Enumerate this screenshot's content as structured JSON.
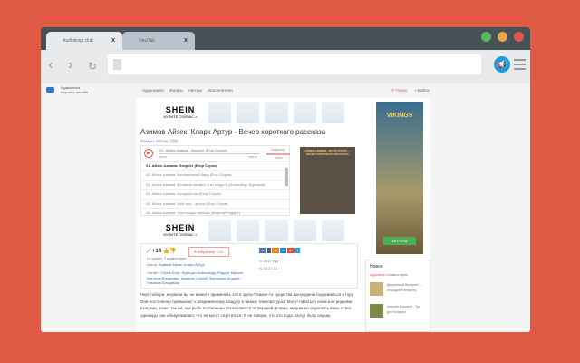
{
  "tabs": [
    {
      "label": "Audioknigi.club",
      "close": "x"
    },
    {
      "label": "NewTab",
      "close": "x"
    }
  ],
  "window_controls": {
    "colors": [
      "#5cb85c",
      "#e8a94b",
      "#e0544a"
    ]
  },
  "extension": {
    "icon": "megaphone-icon"
  },
  "site": {
    "logo_line1": "Аудиокниги",
    "logo_line2": "слушать онлайн",
    "nav": [
      "Аудиокниги",
      "Жанры",
      "Авторы",
      "Исполнители"
    ],
    "search": "Поиск",
    "login": "Войти",
    "ad_brand": "SHEIN",
    "ad_cta": "КУПИТЕ СЕЙЧАС >",
    "title": "Азимов Айзек, Кларк Артур - Вечер короткого рассказа",
    "genre": "РОМАН, ПРОЗА",
    "views": "776",
    "player": {
      "now": "01. Айзек Азимов. Эзорект (Егор Серов)",
      "time_start": "00:00",
      "time_end": "0:49:11",
      "speed_label": "Скорость",
      "speed": "1.0x",
      "volume": "100%"
    },
    "tracks": [
      "01. Айзек Азимов. Эзорект (Егор Серов)",
      "02. Айзек Азимов. Бессмертный бард (Егор Серов)",
      "03. Айзек Азимов. Вставьте шплинт А в гнездо Б (Александр Курицын)",
      "04. Айзек Азимов. Который час (Егор Серов)",
      "05. Айзек Азимов. Мой сын - физик (Егор Серов)",
      "06. Айзек Азимов. Настоящая любовь (Жирний Радцит)"
    ],
    "cover": "АЙЗЕК АЗИМОВ, АРТУР КЛАРК — ВЕЧЕР КОРОТКОГО РАССКАЗА",
    "rating": "+14",
    "favorite": "В избранное",
    "fav_count": "41",
    "comments": "14 лучших, 3 комментария",
    "author_label": "Автор:",
    "authors": "Азимов Айзек, Кларк Артур",
    "reader_label": "Читает:",
    "readers": "Серов Егор, Курицын Александр, Радцит Кирилл, Антонов Владимир, Казаков Сергей, Филиппов Андрей, Ломакин Владимир",
    "year": "2017 год",
    "duration": "02:17:21",
    "share": [
      "vk",
      "f",
      "ok",
      "m",
      "g+",
      "t"
    ],
    "description": "Черт побери, неужели вы не можете применить это в здесь? Какие-то существа вынуждены подниматься в гору. Они постепенно привыкают к разреженному воздуху в низких температурах. Могут питаться ноем или редкими птицами, точно так же, как рыба постепенно отказывается от верхней формы, медленно опускаясь вниз. И вот однажды они обнаруживают, что не могут спуститься. Я не говорю, что это вода. Могут быть серым,",
    "side_ad": "VIKINGS",
    "side_ad_btn": "ИГРАТЬ",
    "new_title": "Новое",
    "new_tabs": [
      "Аудиокниги",
      "Комментарии"
    ],
    "new_items": [
      {
        "title": "Дворянский Валерий - ...",
        "sub": "Лёшадка и эсминец"
      },
      {
        "title": "Алешин Василий - Три",
        "sub": "дня Кондора"
      }
    ]
  }
}
